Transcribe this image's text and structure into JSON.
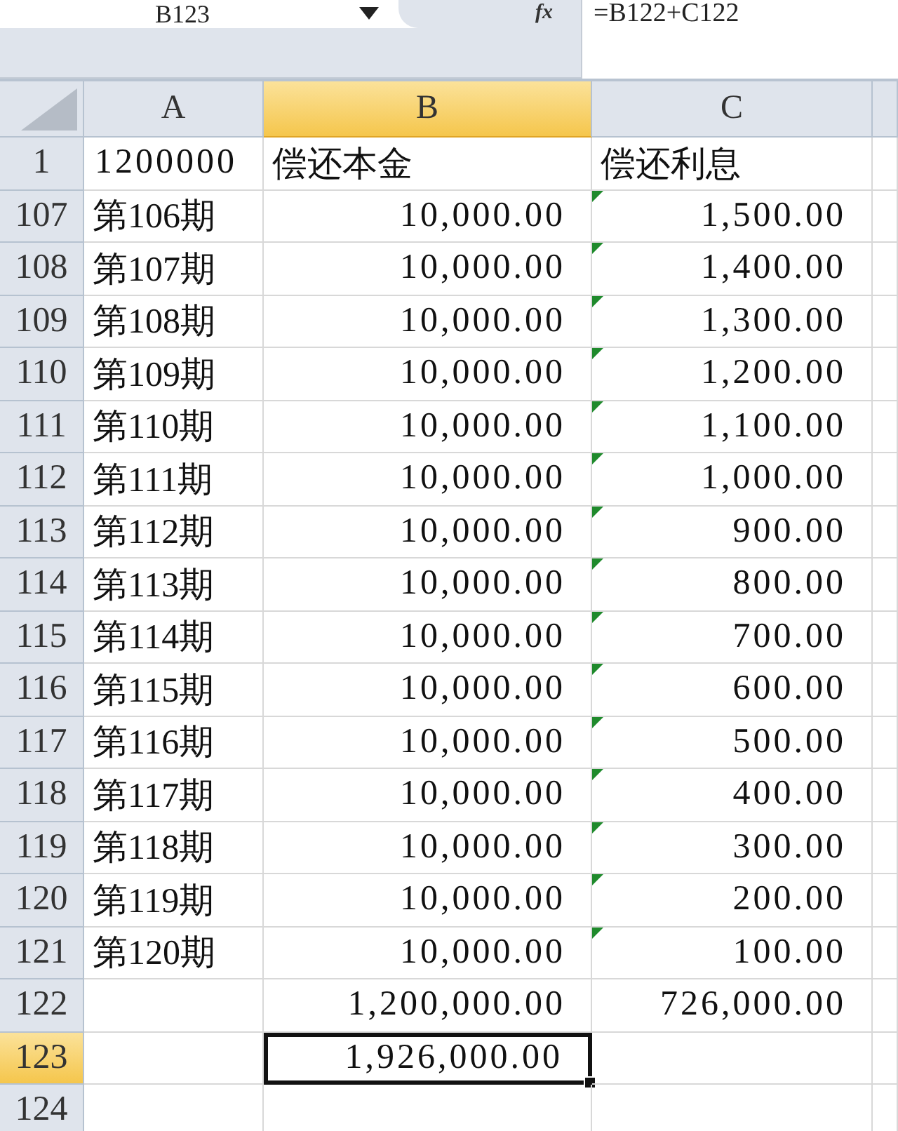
{
  "formula_bar": {
    "name_box": "B123",
    "function_label": "fx",
    "formula": "=B122+C122"
  },
  "columns": [
    {
      "label": "A",
      "selected": false
    },
    {
      "label": "B",
      "selected": true
    },
    {
      "label": "C",
      "selected": false
    }
  ],
  "rows": [
    {
      "number": "1",
      "selected": false,
      "cells": [
        {
          "text": "1200000",
          "kind": "number",
          "flagged": false,
          "active": false
        },
        {
          "text": "偿还本金",
          "kind": "text",
          "flagged": false,
          "active": false
        },
        {
          "text": "偿还利息",
          "kind": "text",
          "flagged": false,
          "active": false
        }
      ]
    },
    {
      "number": "107",
      "selected": false,
      "cells": [
        {
          "text": "第106期",
          "kind": "text",
          "flagged": false,
          "active": false
        },
        {
          "text": "10,000.00",
          "kind": "number",
          "flagged": false,
          "active": false
        },
        {
          "text": "1,500.00",
          "kind": "number",
          "flagged": true,
          "active": false
        }
      ]
    },
    {
      "number": "108",
      "selected": false,
      "cells": [
        {
          "text": "第107期",
          "kind": "text",
          "flagged": false,
          "active": false
        },
        {
          "text": "10,000.00",
          "kind": "number",
          "flagged": false,
          "active": false
        },
        {
          "text": "1,400.00",
          "kind": "number",
          "flagged": true,
          "active": false
        }
      ]
    },
    {
      "number": "109",
      "selected": false,
      "cells": [
        {
          "text": "第108期",
          "kind": "text",
          "flagged": false,
          "active": false
        },
        {
          "text": "10,000.00",
          "kind": "number",
          "flagged": false,
          "active": false
        },
        {
          "text": "1,300.00",
          "kind": "number",
          "flagged": true,
          "active": false
        }
      ]
    },
    {
      "number": "110",
      "selected": false,
      "cells": [
        {
          "text": "第109期",
          "kind": "text",
          "flagged": false,
          "active": false
        },
        {
          "text": "10,000.00",
          "kind": "number",
          "flagged": false,
          "active": false
        },
        {
          "text": "1,200.00",
          "kind": "number",
          "flagged": true,
          "active": false
        }
      ]
    },
    {
      "number": "111",
      "selected": false,
      "cells": [
        {
          "text": "第110期",
          "kind": "text",
          "flagged": false,
          "active": false
        },
        {
          "text": "10,000.00",
          "kind": "number",
          "flagged": false,
          "active": false
        },
        {
          "text": "1,100.00",
          "kind": "number",
          "flagged": true,
          "active": false
        }
      ]
    },
    {
      "number": "112",
      "selected": false,
      "cells": [
        {
          "text": "第111期",
          "kind": "text",
          "flagged": false,
          "active": false
        },
        {
          "text": "10,000.00",
          "kind": "number",
          "flagged": false,
          "active": false
        },
        {
          "text": "1,000.00",
          "kind": "number",
          "flagged": true,
          "active": false
        }
      ]
    },
    {
      "number": "113",
      "selected": false,
      "cells": [
        {
          "text": "第112期",
          "kind": "text",
          "flagged": false,
          "active": false
        },
        {
          "text": "10,000.00",
          "kind": "number",
          "flagged": false,
          "active": false
        },
        {
          "text": "900.00",
          "kind": "number",
          "flagged": true,
          "active": false
        }
      ]
    },
    {
      "number": "114",
      "selected": false,
      "cells": [
        {
          "text": "第113期",
          "kind": "text",
          "flagged": false,
          "active": false
        },
        {
          "text": "10,000.00",
          "kind": "number",
          "flagged": false,
          "active": false
        },
        {
          "text": "800.00",
          "kind": "number",
          "flagged": true,
          "active": false
        }
      ]
    },
    {
      "number": "115",
      "selected": false,
      "cells": [
        {
          "text": "第114期",
          "kind": "text",
          "flagged": false,
          "active": false
        },
        {
          "text": "10,000.00",
          "kind": "number",
          "flagged": false,
          "active": false
        },
        {
          "text": "700.00",
          "kind": "number",
          "flagged": true,
          "active": false
        }
      ]
    },
    {
      "number": "116",
      "selected": false,
      "cells": [
        {
          "text": "第115期",
          "kind": "text",
          "flagged": false,
          "active": false
        },
        {
          "text": "10,000.00",
          "kind": "number",
          "flagged": false,
          "active": false
        },
        {
          "text": "600.00",
          "kind": "number",
          "flagged": true,
          "active": false
        }
      ]
    },
    {
      "number": "117",
      "selected": false,
      "cells": [
        {
          "text": "第116期",
          "kind": "text",
          "flagged": false,
          "active": false
        },
        {
          "text": "10,000.00",
          "kind": "number",
          "flagged": false,
          "active": false
        },
        {
          "text": "500.00",
          "kind": "number",
          "flagged": true,
          "active": false
        }
      ]
    },
    {
      "number": "118",
      "selected": false,
      "cells": [
        {
          "text": "第117期",
          "kind": "text",
          "flagged": false,
          "active": false
        },
        {
          "text": "10,000.00",
          "kind": "number",
          "flagged": false,
          "active": false
        },
        {
          "text": "400.00",
          "kind": "number",
          "flagged": true,
          "active": false
        }
      ]
    },
    {
      "number": "119",
      "selected": false,
      "cells": [
        {
          "text": "第118期",
          "kind": "text",
          "flagged": false,
          "active": false
        },
        {
          "text": "10,000.00",
          "kind": "number",
          "flagged": false,
          "active": false
        },
        {
          "text": "300.00",
          "kind": "number",
          "flagged": true,
          "active": false
        }
      ]
    },
    {
      "number": "120",
      "selected": false,
      "cells": [
        {
          "text": "第119期",
          "kind": "text",
          "flagged": false,
          "active": false
        },
        {
          "text": "10,000.00",
          "kind": "number",
          "flagged": false,
          "active": false
        },
        {
          "text": "200.00",
          "kind": "number",
          "flagged": true,
          "active": false
        }
      ]
    },
    {
      "number": "121",
      "selected": false,
      "cells": [
        {
          "text": "第120期",
          "kind": "text",
          "flagged": false,
          "active": false
        },
        {
          "text": "10,000.00",
          "kind": "number",
          "flagged": false,
          "active": false
        },
        {
          "text": "100.00",
          "kind": "number",
          "flagged": true,
          "active": false
        }
      ]
    },
    {
      "number": "122",
      "selected": false,
      "cells": [
        null,
        {
          "text": "1,200,000.00",
          "kind": "number",
          "flagged": false,
          "active": false
        },
        {
          "text": "726,000.00",
          "kind": "number",
          "flagged": false,
          "active": false
        }
      ]
    },
    {
      "number": "123",
      "selected": true,
      "cells": [
        null,
        {
          "text": "1,926,000.00",
          "kind": "number",
          "flagged": false,
          "active": true
        },
        null
      ]
    },
    {
      "number": "124",
      "selected": false,
      "cells": [
        null,
        null,
        null
      ]
    }
  ]
}
